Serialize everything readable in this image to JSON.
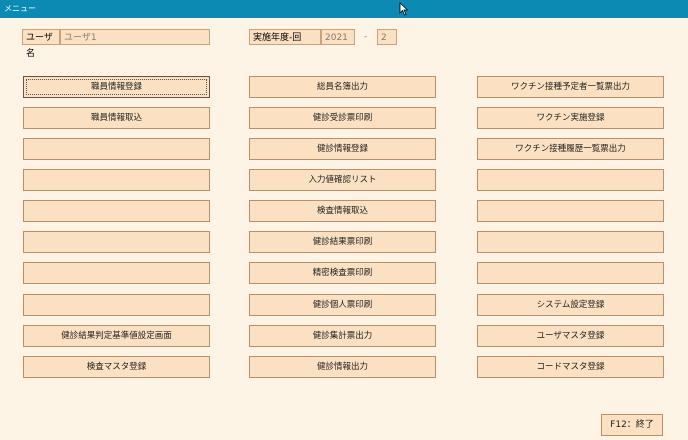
{
  "window": {
    "title": "メニュー"
  },
  "header": {
    "user_label": "ユーザ名",
    "user_value": "ユーザ1",
    "year_label": "実施年度-回",
    "year_value": "2021",
    "separator": "-",
    "round_value": "2"
  },
  "menu": {
    "col1": [
      "職員情報登録",
      "職員情報取込",
      "",
      "",
      "",
      "",
      "",
      "",
      "健診結果判定基準値設定画面",
      "検査マスタ登録"
    ],
    "col2": [
      "総員名簿出力",
      "健診受診票印刷",
      "健診情報登録",
      "入力値確認リスト",
      "検査情報取込",
      "健診結果票印刷",
      "精密検査票印刷",
      "健診個人票印刷",
      "健診集計票出力",
      "健診情報出力"
    ],
    "col3": [
      "ワクチン接種予定者一覧票出力",
      "ワクチン実施登録",
      "ワクチン接種履歴一覧票出力",
      "",
      "",
      "",
      "",
      "システム設定登録",
      "ユーザマスタ登録",
      "コードマスタ登録"
    ]
  },
  "footer": {
    "exit_label": "F12：終了"
  }
}
